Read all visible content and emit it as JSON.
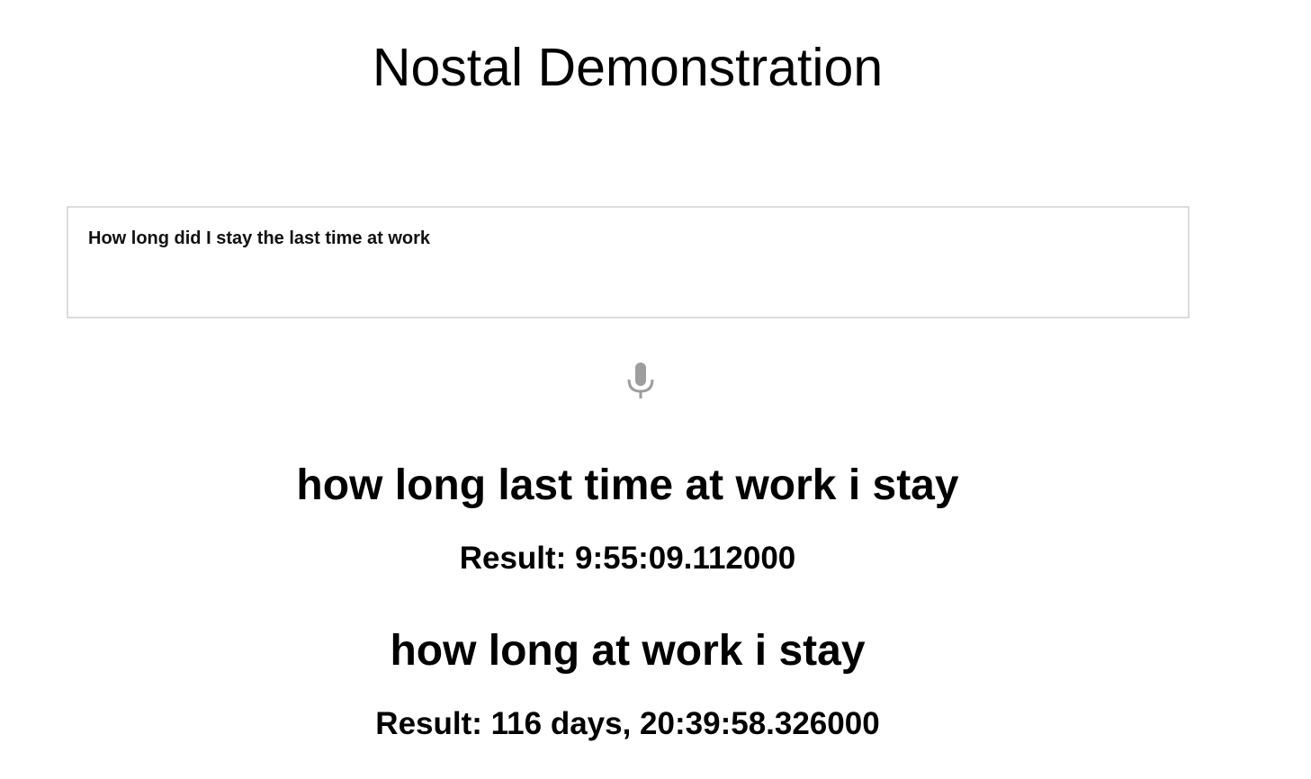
{
  "page": {
    "title": "Nostal Demonstration"
  },
  "query": {
    "value": "How long did I stay the last time at work"
  },
  "mic": {
    "icon": "microphone-icon",
    "color": "#9e9e9e"
  },
  "results": [
    {
      "parsed_query": "how long last time at work i stay",
      "result": "Result: 9:55:09.112000"
    },
    {
      "parsed_query": "how long at work i stay",
      "result": "Result: 116 days, 20:39:58.326000"
    }
  ]
}
